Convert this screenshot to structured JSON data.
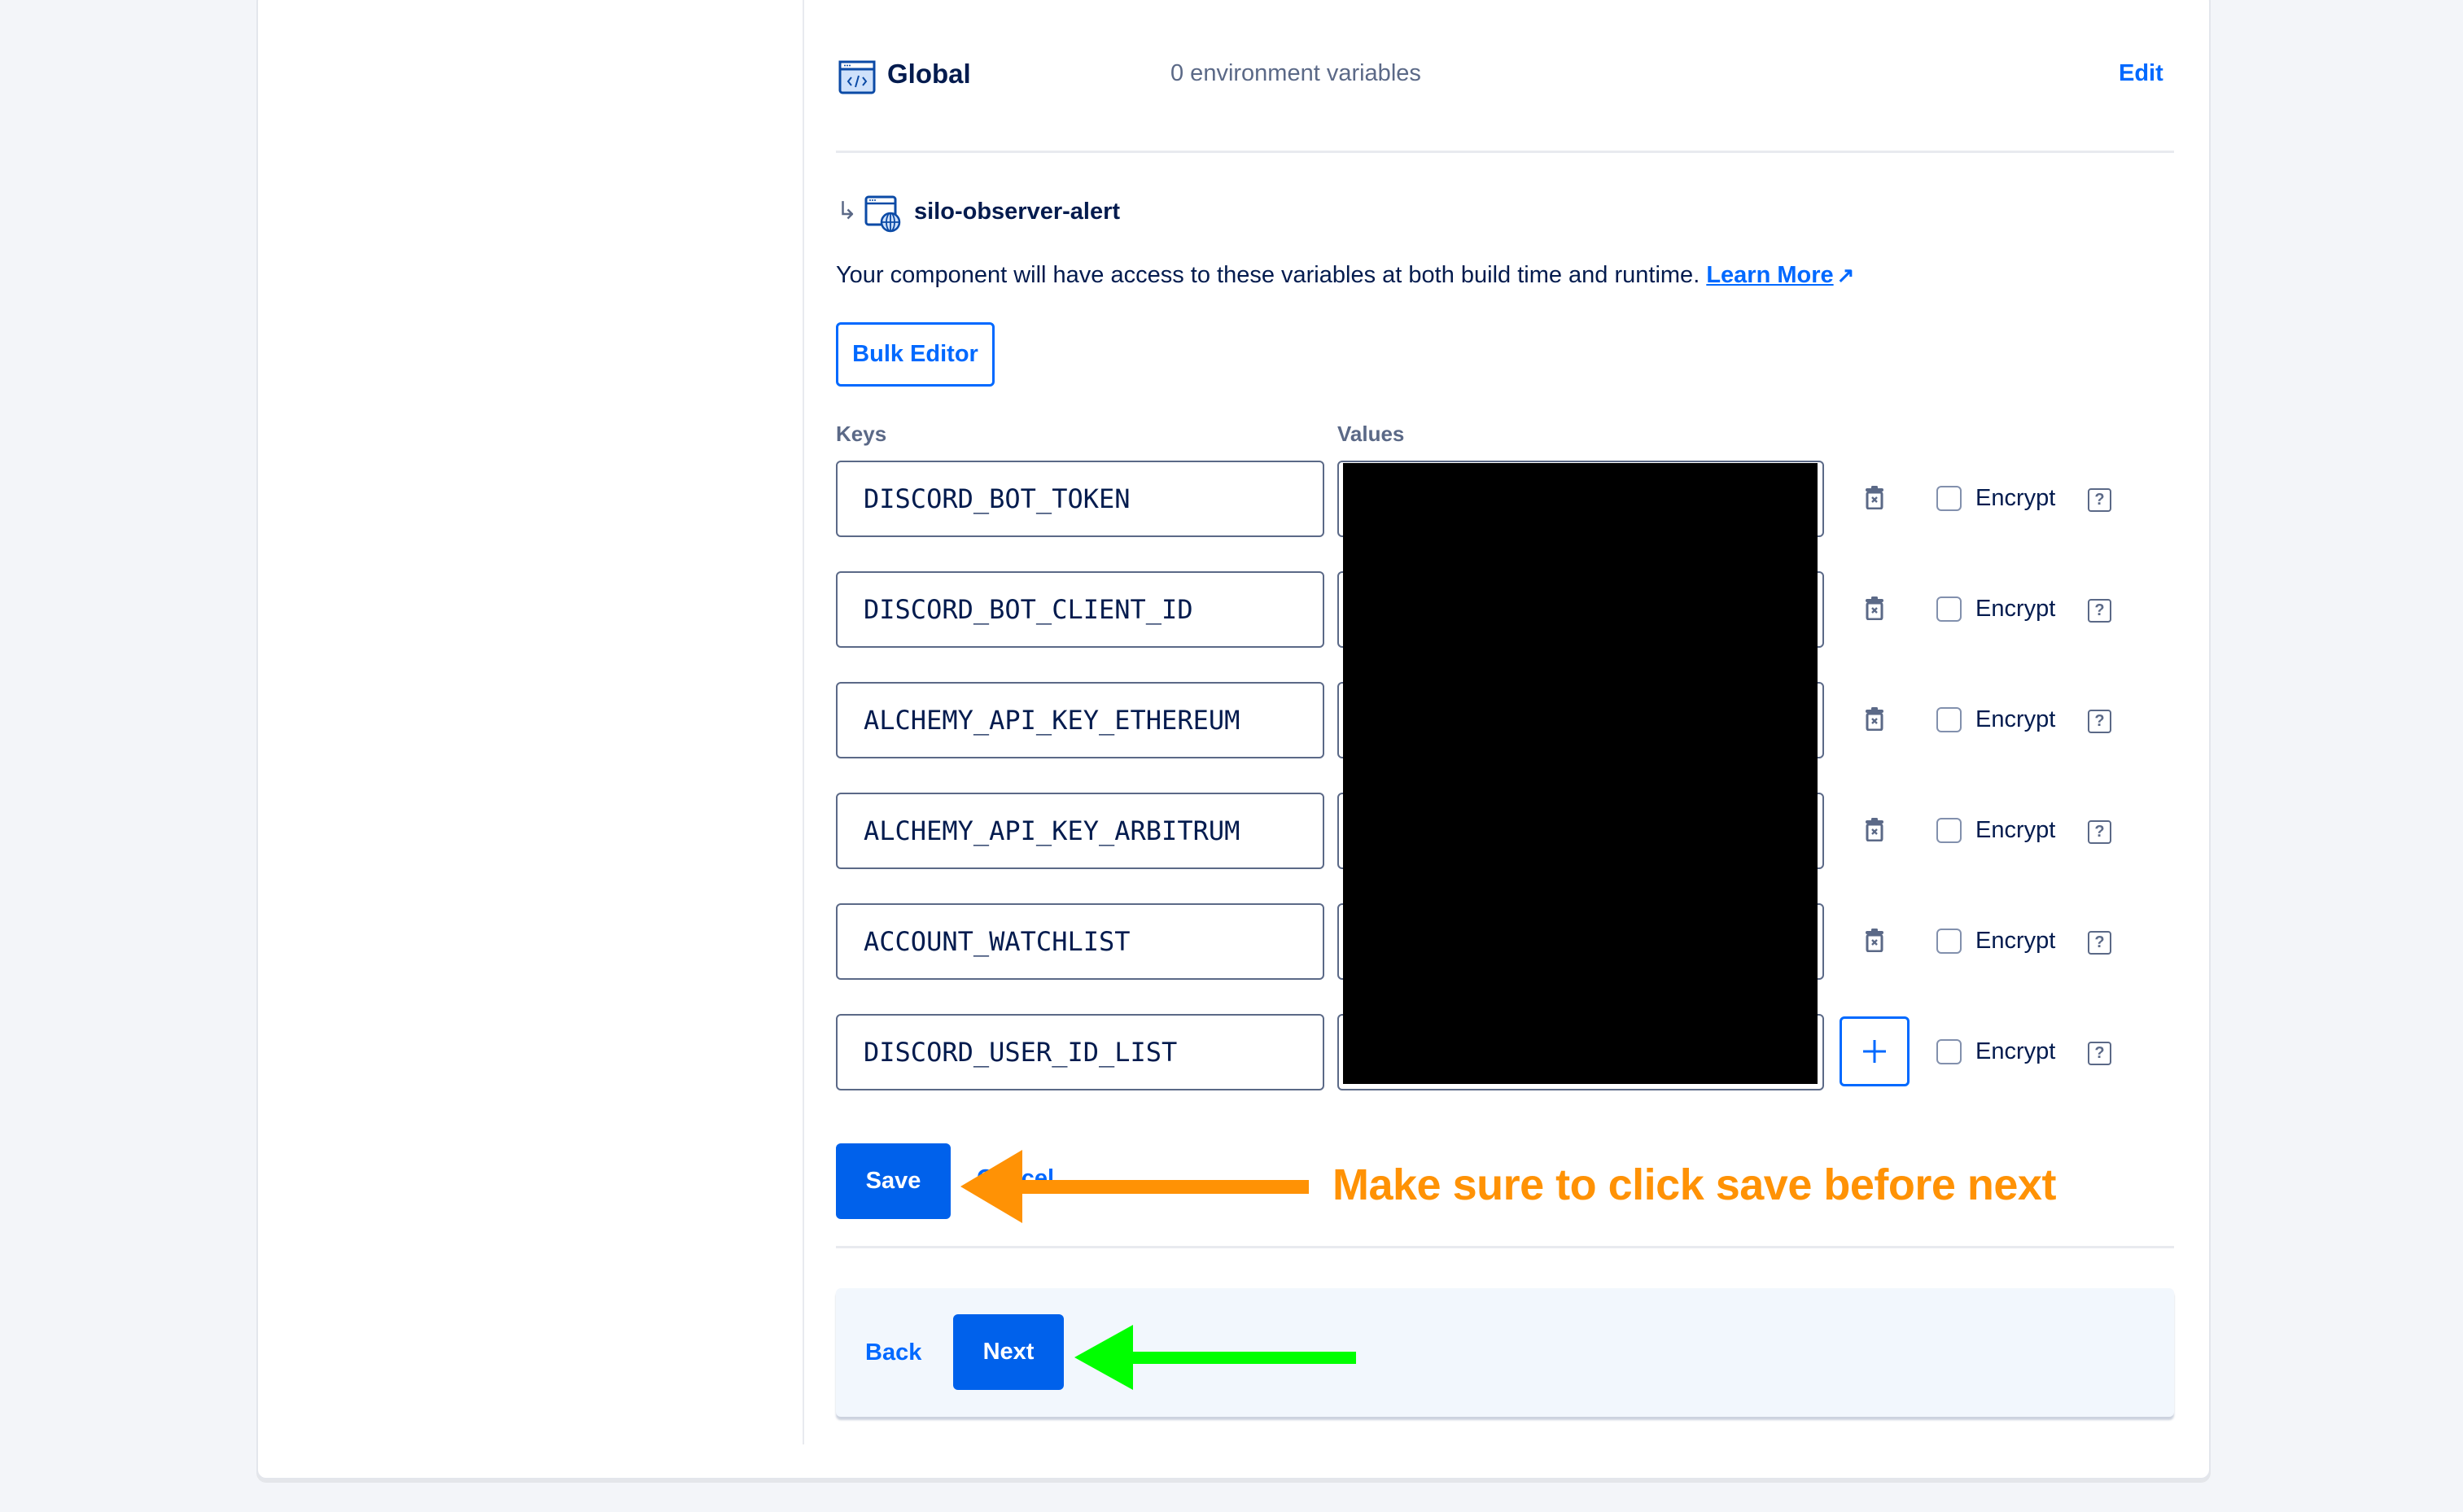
{
  "global": {
    "title": "Global",
    "count_text": "0 environment variables",
    "edit_label": "Edit"
  },
  "component": {
    "sub_arrow": "↳",
    "name": "silo-observer-alert",
    "description": "Your component will have access to these variables at both build time and runtime.",
    "learn_more_label": "Learn More",
    "learn_more_icon": "↗",
    "bulk_editor_label": "Bulk Editor"
  },
  "table": {
    "keys_header": "Keys",
    "values_header": "Values",
    "rows": [
      {
        "key": "DISCORD_BOT_TOKEN",
        "value": "",
        "encrypt_label": "Encrypt",
        "encrypt": false,
        "action": "delete"
      },
      {
        "key": "DISCORD_BOT_CLIENT_ID",
        "value": "",
        "encrypt_label": "Encrypt",
        "encrypt": false,
        "action": "delete"
      },
      {
        "key": "ALCHEMY_API_KEY_ETHEREUM",
        "value": "",
        "encrypt_label": "Encrypt",
        "encrypt": false,
        "action": "delete"
      },
      {
        "key": "ALCHEMY_API_KEY_ARBITRUM",
        "value": "",
        "encrypt_label": "Encrypt",
        "encrypt": false,
        "action": "delete"
      },
      {
        "key": "ACCOUNT_WATCHLIST",
        "value": "",
        "encrypt_label": "Encrypt",
        "encrypt": false,
        "action": "delete"
      },
      {
        "key": "DISCORD_USER_ID_LIST",
        "value": "",
        "encrypt_label": "Encrypt",
        "encrypt": false,
        "action": "add"
      }
    ],
    "help_glyph": "?"
  },
  "actions": {
    "save_label": "Save",
    "cancel_label": "Cancel"
  },
  "annotation": {
    "text": "Make sure to click save before next",
    "color": "#ff9205",
    "next_arrow_color": "#00ff00"
  },
  "footer": {
    "back_label": "Back",
    "next_label": "Next"
  },
  "colors": {
    "accent": "#0069ff",
    "primary_button": "#0061eb",
    "text": "#031b4e",
    "muted": "#5b6987"
  }
}
